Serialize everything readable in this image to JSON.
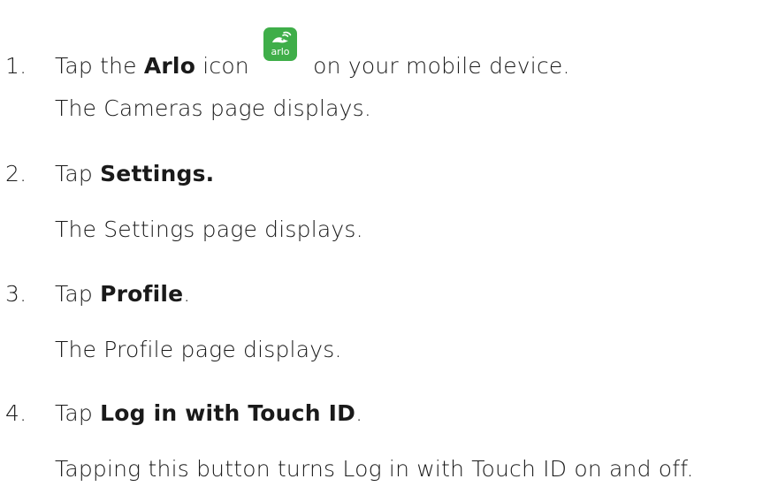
{
  "steps": [
    {
      "number": "1.",
      "pre": "Tap the ",
      "bold": "Arlo",
      "post_bold": " icon",
      "icon": "arlo-app-icon",
      "icon_text": "arlo",
      "after_icon": "on your mobile device.",
      "result": "The Cameras page displays."
    },
    {
      "number": "2.",
      "pre": "Tap ",
      "bold": "Settings.",
      "post": "",
      "result": "The Settings page displays."
    },
    {
      "number": "3.",
      "pre": "Tap ",
      "bold": "Profile",
      "post": ".",
      "result": "The Profile page displays."
    },
    {
      "number": "4.",
      "pre": "Tap ",
      "bold": "Log in with Touch ID",
      "post": ".",
      "result": "Tapping this button turns Log in with Touch ID on and off."
    }
  ],
  "colors": {
    "text": "#1a1a1a",
    "arlo_green": "#3fae49"
  }
}
